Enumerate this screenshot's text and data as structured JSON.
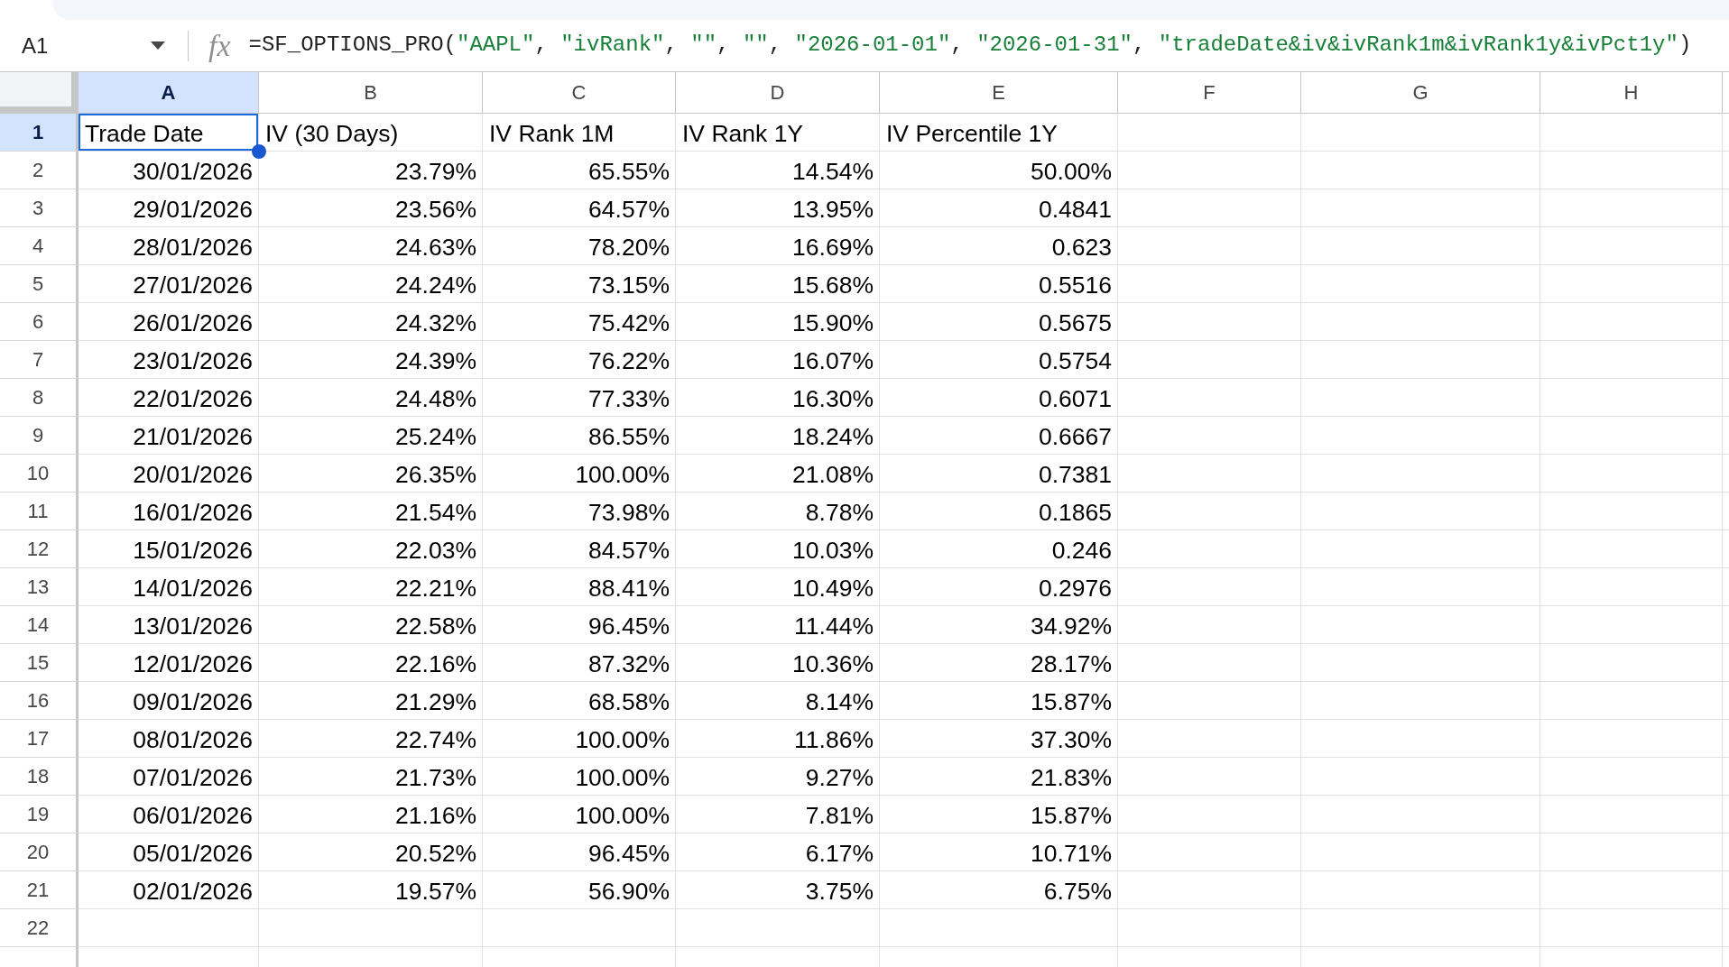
{
  "name_box": {
    "value": "A1"
  },
  "formula_bar": {
    "fx_label": "fx",
    "tokens": [
      {
        "kind": "plain",
        "text": "=SF_OPTIONS_PRO("
      },
      {
        "kind": "string",
        "text": "\"AAPL\""
      },
      {
        "kind": "plain",
        "text": ", "
      },
      {
        "kind": "string",
        "text": "\"ivRank\""
      },
      {
        "kind": "plain",
        "text": ", "
      },
      {
        "kind": "string",
        "text": "\"\""
      },
      {
        "kind": "plain",
        "text": ", "
      },
      {
        "kind": "string",
        "text": "\"\""
      },
      {
        "kind": "plain",
        "text": ", "
      },
      {
        "kind": "string",
        "text": "\"2026-01-01\""
      },
      {
        "kind": "plain",
        "text": ", "
      },
      {
        "kind": "string",
        "text": "\"2026-01-31\""
      },
      {
        "kind": "plain",
        "text": ", "
      },
      {
        "kind": "string",
        "text": "\"tradeDate&iv&ivRank1m&ivRank1y&ivPct1y\""
      },
      {
        "kind": "plain",
        "text": ")"
      }
    ]
  },
  "sheet": {
    "columns": [
      {
        "label": "A",
        "selected": true
      },
      {
        "label": "B",
        "selected": false
      },
      {
        "label": "C",
        "selected": false
      },
      {
        "label": "D",
        "selected": false
      },
      {
        "label": "E",
        "selected": false
      },
      {
        "label": "F",
        "selected": false
      },
      {
        "label": "G",
        "selected": false
      },
      {
        "label": "H",
        "selected": false
      }
    ],
    "rows": [
      {
        "number": "1",
        "selected": true,
        "kind": "header",
        "cells": [
          "Trade Date",
          "IV (30 Days)",
          "IV Rank 1M",
          "IV Rank 1Y",
          "IV Percentile 1Y"
        ]
      },
      {
        "number": "2",
        "selected": false,
        "kind": "data",
        "cells": [
          "30/01/2026",
          "23.79%",
          "65.55%",
          "14.54%",
          "50.00%"
        ]
      },
      {
        "number": "3",
        "selected": false,
        "kind": "data",
        "cells": [
          "29/01/2026",
          "23.56%",
          "64.57%",
          "13.95%",
          "0.4841"
        ]
      },
      {
        "number": "4",
        "selected": false,
        "kind": "data",
        "cells": [
          "28/01/2026",
          "24.63%",
          "78.20%",
          "16.69%",
          "0.623"
        ]
      },
      {
        "number": "5",
        "selected": false,
        "kind": "data",
        "cells": [
          "27/01/2026",
          "24.24%",
          "73.15%",
          "15.68%",
          "0.5516"
        ]
      },
      {
        "number": "6",
        "selected": false,
        "kind": "data",
        "cells": [
          "26/01/2026",
          "24.32%",
          "75.42%",
          "15.90%",
          "0.5675"
        ]
      },
      {
        "number": "7",
        "selected": false,
        "kind": "data",
        "cells": [
          "23/01/2026",
          "24.39%",
          "76.22%",
          "16.07%",
          "0.5754"
        ]
      },
      {
        "number": "8",
        "selected": false,
        "kind": "data",
        "cells": [
          "22/01/2026",
          "24.48%",
          "77.33%",
          "16.30%",
          "0.6071"
        ]
      },
      {
        "number": "9",
        "selected": false,
        "kind": "data",
        "cells": [
          "21/01/2026",
          "25.24%",
          "86.55%",
          "18.24%",
          "0.6667"
        ]
      },
      {
        "number": "10",
        "selected": false,
        "kind": "data",
        "cells": [
          "20/01/2026",
          "26.35%",
          "100.00%",
          "21.08%",
          "0.7381"
        ]
      },
      {
        "number": "11",
        "selected": false,
        "kind": "data",
        "cells": [
          "16/01/2026",
          "21.54%",
          "73.98%",
          "8.78%",
          "0.1865"
        ]
      },
      {
        "number": "12",
        "selected": false,
        "kind": "data",
        "cells": [
          "15/01/2026",
          "22.03%",
          "84.57%",
          "10.03%",
          "0.246"
        ]
      },
      {
        "number": "13",
        "selected": false,
        "kind": "data",
        "cells": [
          "14/01/2026",
          "22.21%",
          "88.41%",
          "10.49%",
          "0.2976"
        ]
      },
      {
        "number": "14",
        "selected": false,
        "kind": "data",
        "cells": [
          "13/01/2026",
          "22.58%",
          "96.45%",
          "11.44%",
          "34.92%"
        ]
      },
      {
        "number": "15",
        "selected": false,
        "kind": "data",
        "cells": [
          "12/01/2026",
          "22.16%",
          "87.32%",
          "10.36%",
          "28.17%"
        ]
      },
      {
        "number": "16",
        "selected": false,
        "kind": "data",
        "cells": [
          "09/01/2026",
          "21.29%",
          "68.58%",
          "8.14%",
          "15.87%"
        ]
      },
      {
        "number": "17",
        "selected": false,
        "kind": "data",
        "cells": [
          "08/01/2026",
          "22.74%",
          "100.00%",
          "11.86%",
          "37.30%"
        ]
      },
      {
        "number": "18",
        "selected": false,
        "kind": "data",
        "cells": [
          "07/01/2026",
          "21.73%",
          "100.00%",
          "9.27%",
          "21.83%"
        ]
      },
      {
        "number": "19",
        "selected": false,
        "kind": "data",
        "cells": [
          "06/01/2026",
          "21.16%",
          "100.00%",
          "7.81%",
          "15.87%"
        ]
      },
      {
        "number": "20",
        "selected": false,
        "kind": "data",
        "cells": [
          "05/01/2026",
          "20.52%",
          "96.45%",
          "6.17%",
          "10.71%"
        ]
      },
      {
        "number": "21",
        "selected": false,
        "kind": "data",
        "cells": [
          "02/01/2026",
          "19.57%",
          "56.90%",
          "3.75%",
          "6.75%"
        ]
      },
      {
        "number": "22",
        "selected": false
      }
    ]
  }
}
